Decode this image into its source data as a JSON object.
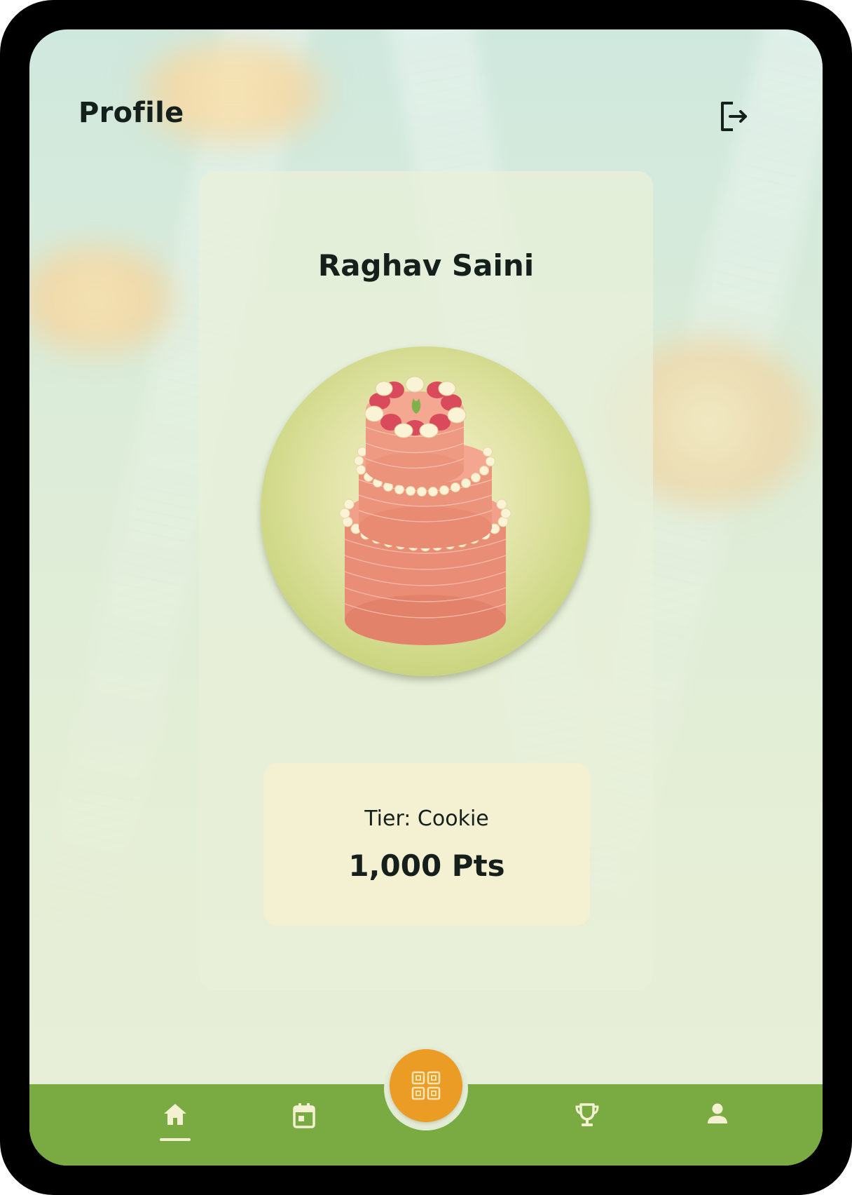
{
  "header": {
    "title": "Profile",
    "logout_icon": "logout-icon"
  },
  "profile": {
    "name": "Raghav Saini",
    "avatar_image": "three-tier-strawberry-cake",
    "tier_label": "Tier: Cookie",
    "points": "1,000 Pts"
  },
  "bottom_nav": {
    "items": [
      {
        "icon": "home-icon",
        "active": true
      },
      {
        "icon": "calendar-icon",
        "active": false
      },
      {
        "icon": "qr-code-icon",
        "active": false
      },
      {
        "icon": "trophy-icon",
        "active": false
      },
      {
        "icon": "user-icon",
        "active": false
      }
    ]
  },
  "colors": {
    "nav_background": "#7aab42",
    "scan_button": "#ea9c25",
    "accent_cream": "#f4f1d3",
    "text_dark": "#15201c"
  }
}
